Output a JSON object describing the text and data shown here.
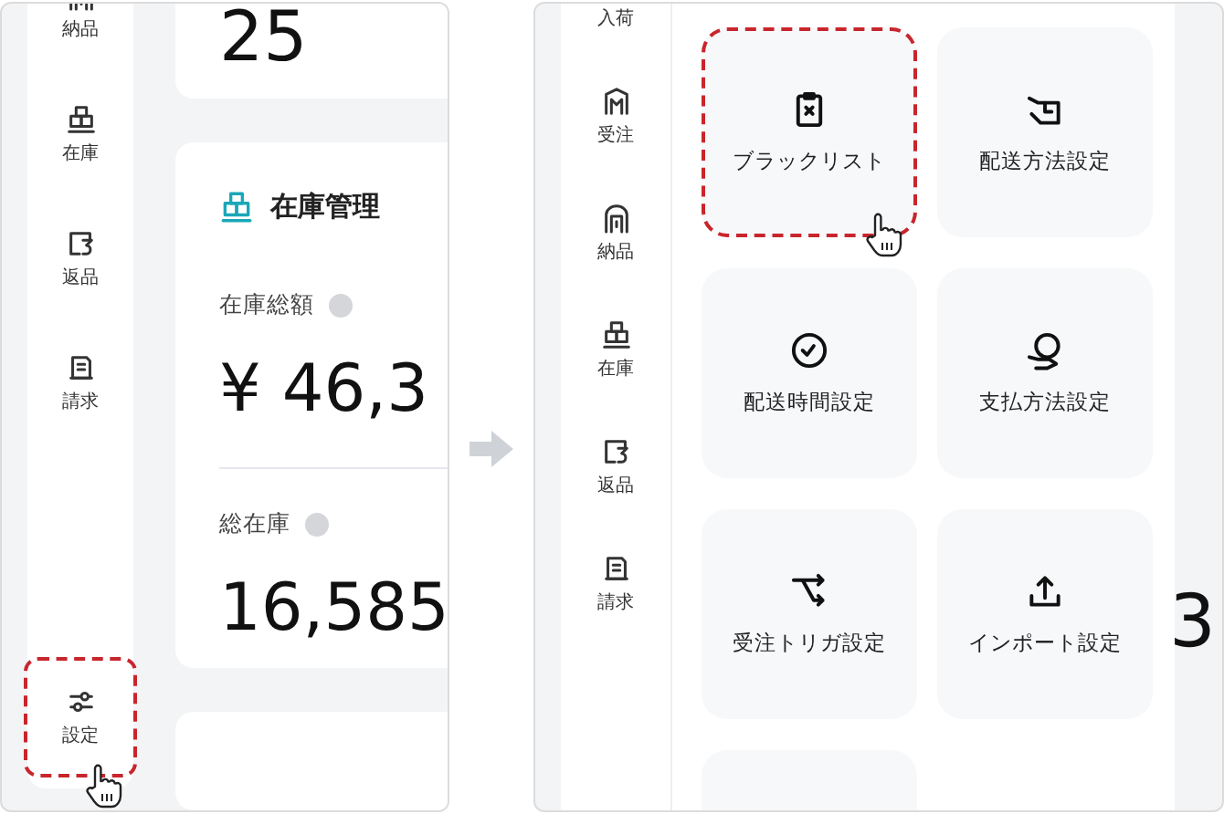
{
  "left_panel": {
    "sidebar_items": [
      {
        "label": "納品",
        "kind": "delivery"
      },
      {
        "label": "在庫",
        "kind": "inventory"
      },
      {
        "label": "返品",
        "kind": "returns"
      },
      {
        "label": "請求",
        "kind": "billing"
      }
    ],
    "settings_item": {
      "label": "設定",
      "highlighted": true
    },
    "top_card": {
      "value": "25"
    },
    "inventory_card": {
      "title": "在庫管理",
      "metrics": [
        {
          "label": "在庫総額",
          "value": "¥ 46,3"
        },
        {
          "label": "総在庫",
          "value": "16,585"
        }
      ]
    }
  },
  "right_panel": {
    "sidebar_items": [
      {
        "label": "入荷",
        "kind": "arrival"
      },
      {
        "label": "受注",
        "kind": "order"
      },
      {
        "label": "納品",
        "kind": "delivery"
      },
      {
        "label": "在庫",
        "kind": "inventory"
      },
      {
        "label": "返品",
        "kind": "returns"
      },
      {
        "label": "請求",
        "kind": "billing"
      }
    ],
    "tiles": [
      {
        "label": "ブラックリスト",
        "kind": "blacklist",
        "highlighted": true
      },
      {
        "label": "配送方法設定",
        "kind": "shipping",
        "highlighted": false
      },
      {
        "label": "配送時間設定",
        "kind": "clock",
        "highlighted": false
      },
      {
        "label": "支払方法設定",
        "kind": "payment",
        "highlighted": false
      },
      {
        "label": "受注トリガ設定",
        "kind": "trigger",
        "highlighted": false
      },
      {
        "label": "インポート設定",
        "kind": "upload",
        "highlighted": false
      },
      {
        "kind": "blank",
        "highlighted": false
      }
    ],
    "background_value": "3"
  }
}
